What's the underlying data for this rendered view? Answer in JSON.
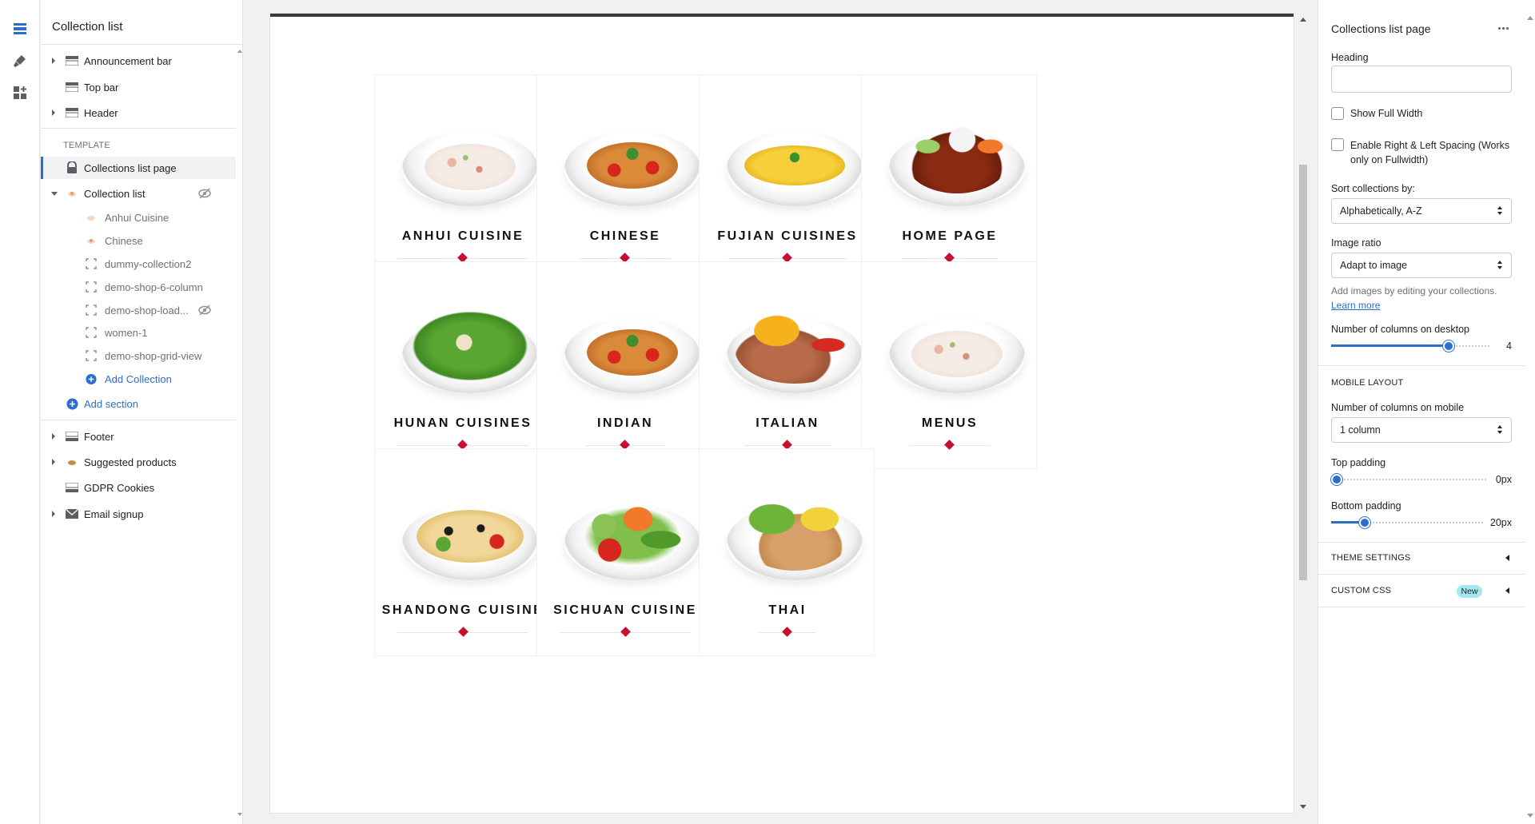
{
  "colors": {
    "accent": "#2c6ecb",
    "diamond": "#c8102e",
    "badge": "#a4e8f2"
  },
  "sidebar": {
    "title": "Collection list",
    "template_label": "TEMPLATE",
    "header_items": [
      {
        "label": "Announcement bar",
        "icon": "section-icon",
        "expandable": true
      },
      {
        "label": "Top bar",
        "icon": "section-icon",
        "expandable": false
      },
      {
        "label": "Header",
        "icon": "section-icon",
        "expandable": true
      }
    ],
    "page_item": {
      "label": "Collections list page",
      "icon": "lock-icon"
    },
    "collection_list": {
      "label": "Collection list",
      "children": [
        {
          "label": "Anhui Cuisine",
          "icon": "collection-thumb-icon"
        },
        {
          "label": "Chinese",
          "icon": "collection-thumb-icon"
        },
        {
          "label": "dummy-collection2",
          "icon": "empty-frame-icon"
        },
        {
          "label": "demo-shop-6-column",
          "icon": "empty-frame-icon"
        },
        {
          "label": "demo-shop-load...",
          "icon": "empty-frame-icon",
          "hidden": true
        },
        {
          "label": "women-1",
          "icon": "empty-frame-icon"
        },
        {
          "label": "demo-shop-grid-view",
          "icon": "empty-frame-icon"
        }
      ],
      "add_label": "Add Collection"
    },
    "add_section_label": "Add section",
    "footer_items": [
      {
        "label": "Footer",
        "icon": "section-icon",
        "expandable": true
      },
      {
        "label": "Suggested products",
        "icon": "products-icon",
        "expandable": true
      },
      {
        "label": "GDPR Cookies",
        "icon": "section-icon",
        "expandable": false
      },
      {
        "label": "Email signup",
        "icon": "mail-icon",
        "expandable": true
      }
    ]
  },
  "preview": {
    "cards": [
      {
        "title": "ANHUI CUISINE",
        "food": "rice-salad"
      },
      {
        "title": "CHINESE",
        "food": "spaghetti"
      },
      {
        "title": "FUJIAN CUISINES",
        "food": "fried-rice"
      },
      {
        "title": "HOME PAGE",
        "food": "chicken-wings"
      },
      {
        "title": "HUNAN CUISINES",
        "food": "green-salad"
      },
      {
        "title": "INDIAN",
        "food": "spaghetti"
      },
      {
        "title": "ITALIAN",
        "food": "steak-fries"
      },
      {
        "title": "MENUS",
        "food": "rice-salad"
      },
      {
        "title": "SHANDONG CUISINE",
        "food": "pasta-salad"
      },
      {
        "title": "SICHUAN CUISINE",
        "food": "vegetables"
      },
      {
        "title": "THAI",
        "food": "grilled-chicken"
      }
    ]
  },
  "settings": {
    "title": "Collections list page",
    "heading_label": "Heading",
    "heading_value": "",
    "show_full_width_label": "Show Full Width",
    "show_full_width": false,
    "spacing_label": "Enable Right & Left Spacing (Works only on Fullwidth)",
    "spacing": false,
    "sort_label": "Sort collections by:",
    "sort_value": "Alphabetically, A-Z",
    "ratio_label": "Image ratio",
    "ratio_value": "Adapt to image",
    "help_text": "Add images by editing your collections.",
    "learn_more": "Learn more",
    "columns_desktop_label": "Number of columns on desktop",
    "columns_desktop_value": "4",
    "columns_desktop_fraction": 0.75,
    "mobile_layout_label": "MOBILE LAYOUT",
    "columns_mobile_label": "Number of columns on mobile",
    "columns_mobile_value": "1 column",
    "top_padding_label": "Top padding",
    "top_padding_value": "0px",
    "top_padding_fraction": 0.0,
    "bottom_padding_label": "Bottom padding",
    "bottom_padding_value": "20px",
    "bottom_padding_fraction": 0.2,
    "theme_settings_label": "THEME SETTINGS",
    "custom_css_label": "CUSTOM CSS",
    "new_badge": "New"
  }
}
